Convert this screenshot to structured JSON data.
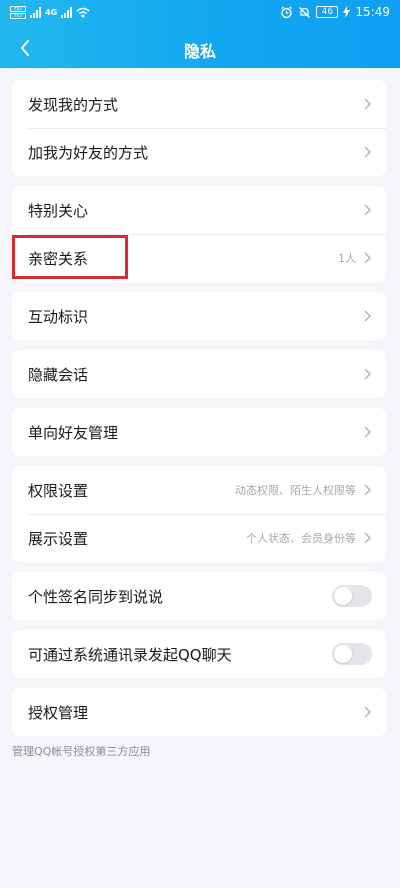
{
  "status_bar": {
    "network": "4G",
    "battery": "46",
    "time": "15:49"
  },
  "header": {
    "title": "隐私",
    "back_icon": "chevron-left-icon"
  },
  "groups": [
    {
      "items": [
        {
          "label": "发现我的方式"
        },
        {
          "label": "加我为好友的方式"
        }
      ]
    },
    {
      "items": [
        {
          "label": "特别关心"
        },
        {
          "label": "亲密关系",
          "value": "1人"
        }
      ]
    },
    {
      "items": [
        {
          "label": "互动标识"
        }
      ]
    },
    {
      "items": [
        {
          "label": "隐藏会话"
        }
      ]
    },
    {
      "items": [
        {
          "label": "单向好友管理"
        }
      ]
    },
    {
      "items": [
        {
          "label": "权限设置",
          "value": "动态权限、陌生人权限等"
        },
        {
          "label": "展示设置",
          "value": "个人状态、会员身份等"
        }
      ]
    },
    {
      "items": [
        {
          "label": "个性签名同步到说说",
          "toggle": false
        }
      ]
    },
    {
      "items": [
        {
          "label": "可通过系统通讯录发起QQ聊天",
          "toggle": false
        }
      ]
    },
    {
      "items": [
        {
          "label": "授权管理"
        }
      ]
    }
  ],
  "footnote": "管理QQ帐号授权第三方应用",
  "colors": {
    "header_gradient_start": "#22b8ee",
    "header_gradient_end": "#0f9ff2",
    "highlight_box": "#d42b34",
    "background": "#f5f6fa"
  }
}
